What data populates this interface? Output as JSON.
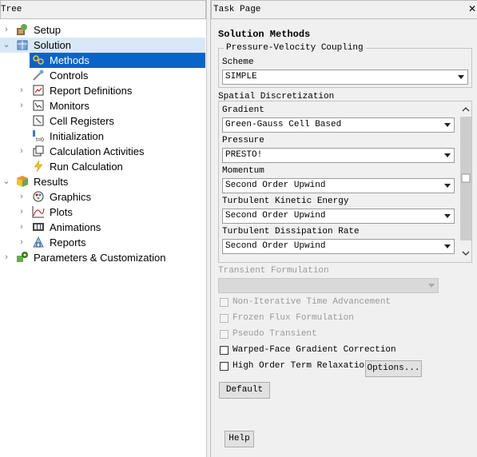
{
  "tree": {
    "header": "Tree",
    "items": [
      {
        "label": "Setup",
        "icon": "setup-icon"
      },
      {
        "label": "Solution",
        "icon": "solution-icon"
      },
      {
        "label": "Methods",
        "icon": "methods-icon"
      },
      {
        "label": "Controls",
        "icon": "controls-icon"
      },
      {
        "label": "Report Definitions",
        "icon": "report-definitions-icon"
      },
      {
        "label": "Monitors",
        "icon": "monitors-icon"
      },
      {
        "label": "Cell Registers",
        "icon": "cell-registers-icon"
      },
      {
        "label": "Initialization",
        "icon": "initialization-icon"
      },
      {
        "label": "Calculation Activities",
        "icon": "calculation-activities-icon"
      },
      {
        "label": "Run Calculation",
        "icon": "run-calculation-icon"
      },
      {
        "label": "Results",
        "icon": "results-icon"
      },
      {
        "label": "Graphics",
        "icon": "graphics-icon"
      },
      {
        "label": "Plots",
        "icon": "plots-icon"
      },
      {
        "label": "Animations",
        "icon": "animations-icon"
      },
      {
        "label": "Reports",
        "icon": "reports-icon"
      },
      {
        "label": "Parameters & Customization",
        "icon": "parameters-icon"
      }
    ]
  },
  "task": {
    "header": "Task Page",
    "title": "Solution Methods",
    "pv_coupling": {
      "group_label": "Pressure-Velocity Coupling",
      "scheme_label": "Scheme",
      "scheme_value": "SIMPLE"
    },
    "spatial": {
      "group_label": "Spatial Discretization",
      "gradient_label": "Gradient",
      "gradient_value": "Green-Gauss Cell Based",
      "pressure_label": "Pressure",
      "pressure_value": "PRESTO!",
      "momentum_label": "Momentum",
      "momentum_value": "Second Order Upwind",
      "tke_label": "Turbulent Kinetic Energy",
      "tke_value": "Second Order Upwind",
      "tdr_label": "Turbulent Dissipation Rate",
      "tdr_value": "Second Order Upwind"
    },
    "transient_label": "Transient Formulation",
    "checkboxes": {
      "non_iterative": "Non-Iterative Time Advancement",
      "frozen_flux": "Frozen Flux Formulation",
      "pseudo_transient": "Pseudo Transient",
      "warped_face": "Warped-Face Gradient Correction",
      "high_order": "High Order Term Relaxation"
    },
    "options_button": "Options...",
    "default_button": "Default",
    "help_button": "Help"
  }
}
